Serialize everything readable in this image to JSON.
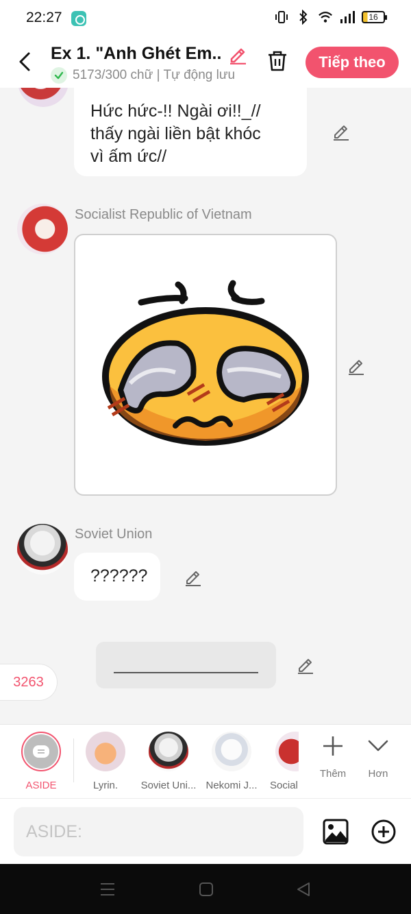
{
  "status_bar": {
    "time": "22:27",
    "battery": "16",
    "icons": [
      "app-notification-icon",
      "vibrate-icon",
      "bluetooth-icon",
      "wifi-icon",
      "signal-icon",
      "battery-icon"
    ]
  },
  "header": {
    "title": "Ex 1. \"Anh Ghét Em...",
    "word_count": "5173/300 chữ | Tự động lưu",
    "next_label": "Tiếp theo"
  },
  "messages": [
    {
      "type": "text",
      "sender": "",
      "text_lines": [
        "Hức hức-!! Ngài ơi!!_//",
        "thấy ngài liền bật khóc",
        "vì ấm ức//"
      ]
    },
    {
      "type": "sticker",
      "sender": "Socialist Republic of Vietnam",
      "sticker": "crying-cursed-emoji"
    },
    {
      "type": "text",
      "sender": "Soviet Union",
      "text": "??????"
    },
    {
      "type": "aside",
      "text": ""
    }
  ],
  "count_badge": "3263",
  "characters": [
    {
      "label": "ASIDE",
      "selected": true
    },
    {
      "label": "Lyrin."
    },
    {
      "label": "Soviet Uni..."
    },
    {
      "label": "Nekomi J..."
    },
    {
      "label": "Social"
    }
  ],
  "tools": {
    "add_label": "Thêm",
    "more_label": "Hơn"
  },
  "input": {
    "placeholder": "ASIDE:"
  },
  "colors": {
    "accent": "#f2536e",
    "background": "#f4f4f4"
  }
}
